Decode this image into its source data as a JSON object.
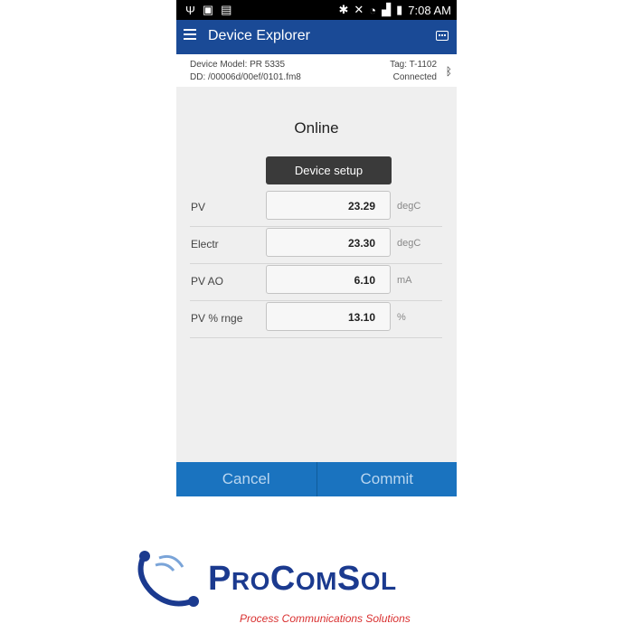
{
  "status_bar": {
    "time": "7:08 AM"
  },
  "app_bar": {
    "title": "Device Explorer"
  },
  "device_info": {
    "model_label": "Device Model:  PR 5335",
    "dd_label": "DD:  /00006d/00ef/0101.fm8",
    "tag_label": "Tag:  T-1102",
    "status": "Connected"
  },
  "main": {
    "heading": "Online",
    "setup_button": "Device setup",
    "rows": [
      {
        "label": "PV",
        "value": "23.29",
        "unit": "degC"
      },
      {
        "label": "Electr",
        "value": "23.30",
        "unit": "degC"
      },
      {
        "label": "PV AO",
        "value": "6.10",
        "unit": "mA"
      },
      {
        "label": "PV % rnge",
        "value": "13.10",
        "unit": "%"
      }
    ]
  },
  "actions": {
    "cancel": "Cancel",
    "commit": "Commit"
  },
  "logo": {
    "part1_big": "P",
    "part1_small": "RO",
    "part2_big": "C",
    "part2_small": "OM",
    "part3_big": "S",
    "part3_small": "OL",
    "tagline": "Process Communications Solutions"
  },
  "colors": {
    "app_bar": "#1a4a96",
    "bottom_bar": "#1a73bf",
    "logo_blue": "#1b3a8f",
    "tagline_red": "#d93030"
  }
}
